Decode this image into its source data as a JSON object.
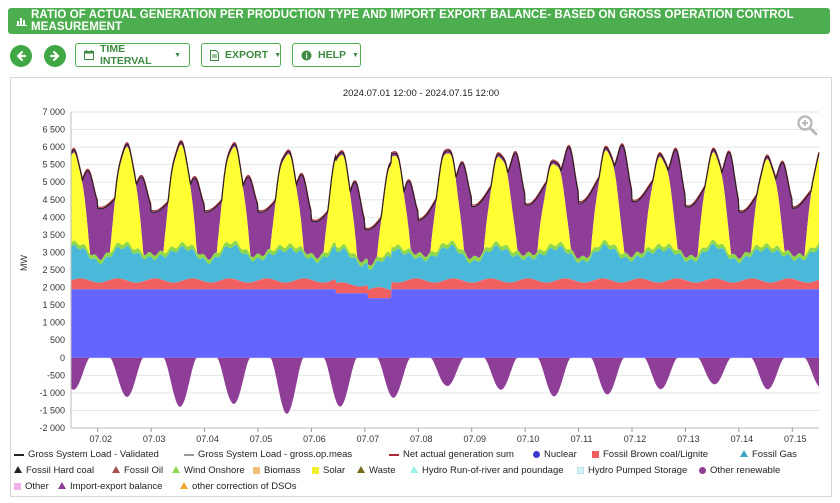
{
  "header": {
    "title": "RATIO OF ACTUAL GENERATION PER PRODUCTION TYPE AND IMPORT EXPORT BALANCE- BASED ON GROSS OPERATION CONTROL MEASUREMENT"
  },
  "toolbar": {
    "time_interval": "TIME INTERVAL",
    "export": "EXPORT",
    "help": "HELP"
  },
  "colors": {
    "brand": "#4cae4f",
    "nuclear": "#6464ff",
    "brown_coal": "#f06060",
    "fossil_gas": "#4ab8d8",
    "solar": "#ffff33",
    "import_export": "#8e3e97",
    "wind": "#8fd84a",
    "biomass": "#f0c078",
    "hydro_ror": "#9ef0ec",
    "hydro_pumped": "#d0f0f8",
    "other": "#f4b0e8",
    "other_correction": "#f0a830",
    "net_sum": "#b02838",
    "gross_load": "#222222",
    "gross_load_meas": "#999999"
  },
  "chart_data": {
    "type": "area",
    "title": "2024.07.01 12:00 - 2024.07.15 12:00",
    "ylabel": "MW",
    "xlabel": "",
    "ylim": [
      -2000,
      7000
    ],
    "yticks": [
      "7 000",
      "6 500",
      "6 000",
      "5 500",
      "5 000",
      "4 500",
      "4 000",
      "3 500",
      "3 000",
      "2 500",
      "2 000",
      "1 500",
      "1 000",
      "500",
      "0",
      "-500",
      "-1 000",
      "-1 500",
      "-2 000"
    ],
    "xticks": [
      "07.02",
      "07.03",
      "07.04",
      "07.05",
      "07.06",
      "07.07",
      "07.08",
      "07.09",
      "07.10",
      "07.11",
      "07.12",
      "07.13",
      "07.14",
      "07.15"
    ],
    "x_daily_dates": [
      "07.01",
      "07.02",
      "07.03",
      "07.04",
      "07.05",
      "07.06",
      "07.07",
      "07.08",
      "07.09",
      "07.10",
      "07.11",
      "07.12",
      "07.13",
      "07.14",
      "07.15"
    ],
    "daily_peak_load": [
      5900,
      5600,
      5600,
      5500,
      5800,
      5700,
      5400,
      6000,
      6400,
      6700,
      6850,
      6600,
      6750,
      6300,
      5900
    ],
    "daily_night_load": [
      4300,
      4200,
      4100,
      4200,
      4100,
      3700,
      3600,
      4200,
      4400,
      4300,
      4500,
      4400,
      4200,
      4100,
      4400
    ],
    "daily_solar_peak": [
      2500,
      2700,
      2800,
      2700,
      2600,
      2600,
      2600,
      2600,
      2500,
      2300,
      2600,
      2500,
      2500,
      2400,
      2500
    ],
    "daily_import_min": [
      -900,
      -1100,
      -1400,
      -1300,
      -1600,
      -1400,
      -1150,
      -800,
      -900,
      -1100,
      -1050,
      -900,
      -750,
      -900,
      -850
    ],
    "nuclear_level": 1950,
    "nuclear_dip": {
      "from": "07.06",
      "to": "07.07",
      "value": 1700
    },
    "brown_coal_band": [
      2200,
      2350
    ],
    "fossil_gas_band": [
      2650,
      3500
    ],
    "legend": [
      {
        "name": "Gross System Load - Validated",
        "color": "#222222",
        "symbol": "line"
      },
      {
        "name": "Gross System Load - gross.op.meas",
        "color": "#999999",
        "symbol": "line"
      },
      {
        "name": "Net actual generation sum",
        "color": "#b02838",
        "symbol": "line"
      },
      {
        "name": "Nuclear",
        "color": "#3a3acf",
        "symbol": "circle"
      },
      {
        "name": "Fossil Brown coal/Lignite",
        "color": "#f06060",
        "symbol": "square"
      },
      {
        "name": "Fossil Gas",
        "color": "#35a8c8",
        "symbol": "triangle"
      },
      {
        "name": "Fossil Hard coal",
        "color": "#222222",
        "symbol": "triangle"
      },
      {
        "name": "Fossil Oil",
        "color": "#a05050",
        "symbol": "triangle"
      },
      {
        "name": "Wind Onshore",
        "color": "#8fd84a",
        "symbol": "triangle"
      },
      {
        "name": "Biomass",
        "color": "#f0c078",
        "symbol": "square"
      },
      {
        "name": "Solar",
        "color": "#f0f030",
        "symbol": "square"
      },
      {
        "name": "Waste",
        "color": "#7a6a20",
        "symbol": "triangle"
      },
      {
        "name": "Hydro Run-of-river and poundage",
        "color": "#9ef0ec",
        "symbol": "triangle"
      },
      {
        "name": "Hydro Pumped Storage",
        "color": "#d0f0f8",
        "symbol": "square"
      },
      {
        "name": "Other renewable",
        "color": "#8e3e97",
        "symbol": "circle"
      },
      {
        "name": "Other",
        "color": "#f4b0e8",
        "symbol": "square"
      },
      {
        "name": "Import-export balance",
        "color": "#8e3e97",
        "symbol": "triangle"
      },
      {
        "name": "other correction of DSOs",
        "color": "#f0a830",
        "symbol": "triangle"
      }
    ]
  }
}
